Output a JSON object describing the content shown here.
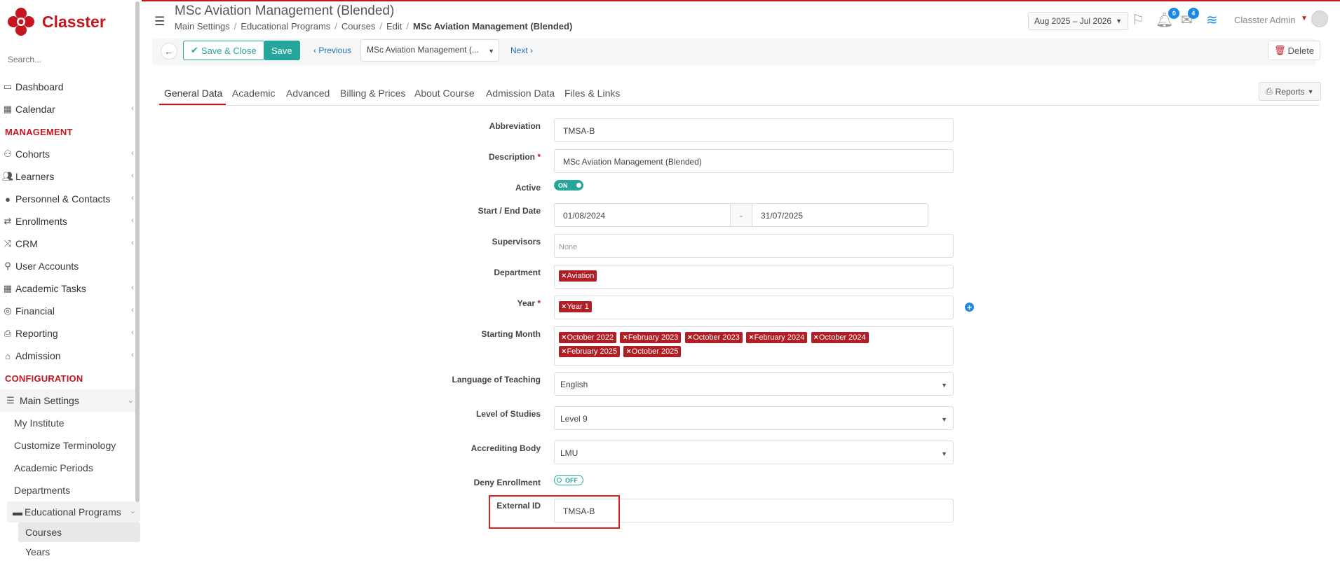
{
  "app": {
    "name": "Classter"
  },
  "sidebar": {
    "search_placeholder": "Search...",
    "top_items": [
      {
        "label": "Dashboard",
        "icon": "monitor-icon"
      },
      {
        "label": "Calendar",
        "icon": "calendar-icon"
      }
    ],
    "management_title": "MANAGEMENT",
    "management_items": [
      {
        "label": "Cohorts",
        "icon": "cohorts-icon"
      },
      {
        "label": "Learners",
        "icon": "learners-icon"
      },
      {
        "label": "Personnel & Contacts",
        "icon": "personnel-icon"
      },
      {
        "label": "Enrollments",
        "icon": "enrollments-icon"
      },
      {
        "label": "CRM",
        "icon": "crm-icon"
      },
      {
        "label": "User Accounts",
        "icon": "user-accounts-icon"
      },
      {
        "label": "Academic Tasks",
        "icon": "academic-tasks-icon"
      },
      {
        "label": "Financial",
        "icon": "financial-icon"
      },
      {
        "label": "Reporting",
        "icon": "reporting-icon"
      },
      {
        "label": "Admission",
        "icon": "admission-icon"
      }
    ],
    "configuration_title": "CONFIGURATION",
    "main_settings": "Main Settings",
    "main_settings_items": [
      "My Institute",
      "Customize Terminology",
      "Academic Periods",
      "Departments"
    ],
    "educational_programs": "Educational Programs",
    "educational_programs_items": [
      "Courses",
      "Years"
    ]
  },
  "header": {
    "title": "MSc Aviation Management (Blended)",
    "breadcrumb": [
      "Main Settings",
      "Educational Programs",
      "Courses",
      "Edit",
      "MSc Aviation Management (Blended)"
    ],
    "period": "Aug 2025 – Jul 2026",
    "notifications_count": "0",
    "messages_count": "4",
    "user_name": "Classter Admin"
  },
  "toolbar": {
    "save_close_label": "Save & Close",
    "save_label": "Save",
    "previous_label": "Previous",
    "course_select_value": "MSc Aviation Management (...",
    "next_label": "Next",
    "delete_label": "Delete"
  },
  "tabs": [
    "General Data",
    "Academic",
    "Advanced",
    "Billing & Prices",
    "About Course",
    "Admission Data",
    "Files & Links"
  ],
  "reports_label": "Reports",
  "form": {
    "abbreviation": {
      "label": "Abbreviation",
      "value": "TMSA-B"
    },
    "description": {
      "label": "Description",
      "value": "MSc Aviation Management (Blended)"
    },
    "active": {
      "label": "Active",
      "value": "ON"
    },
    "dates": {
      "label": "Start / End Date",
      "start": "01/08/2024",
      "sep": "-",
      "end": "31/07/2025"
    },
    "supervisors": {
      "label": "Supervisors",
      "placeholder": "None"
    },
    "department": {
      "label": "Department",
      "tags": [
        "Aviation"
      ]
    },
    "year": {
      "label": "Year",
      "tags": [
        "Year 1"
      ]
    },
    "starting_month": {
      "label": "Starting Month",
      "tags": [
        "October 2022",
        "February 2023",
        "October 2023",
        "February 2024",
        "October 2024",
        "February 2025",
        "October 2025"
      ]
    },
    "language": {
      "label": "Language of Teaching",
      "value": "English"
    },
    "level": {
      "label": "Level of Studies",
      "value": "Level 9"
    },
    "accrediting": {
      "label": "Accrediting Body",
      "value": "LMU"
    },
    "deny_enrollment": {
      "label": "Deny Enrollment",
      "value": "OFF"
    },
    "external_id": {
      "label": "External ID",
      "value": "TMSA-B"
    }
  },
  "colors": {
    "brand": "#c4161c",
    "accent": "#26a69a",
    "link": "#1e6fb8",
    "tag": "#b01e26",
    "badge": "#1e88e5"
  }
}
